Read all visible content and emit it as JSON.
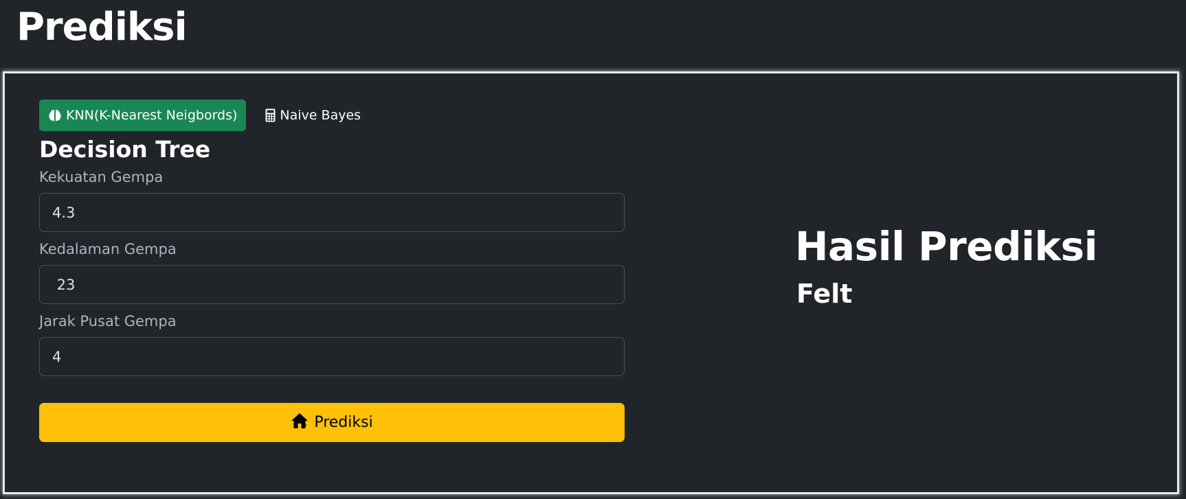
{
  "page": {
    "title": "Prediksi"
  },
  "tabs": [
    {
      "label": "KNN(K-Nearest Neigbords)",
      "icon": "brain-icon",
      "active": true
    },
    {
      "label": "Naive Bayes",
      "icon": "calculator-icon",
      "active": false
    }
  ],
  "form": {
    "section_title": "Decision Tree",
    "fields": [
      {
        "label": "Kekuatan Gempa",
        "value": "4.3"
      },
      {
        "label": "Kedalaman Gempa",
        "value": " 23"
      },
      {
        "label": "Jarak Pusat Gempa",
        "value": "4"
      }
    ],
    "submit": {
      "label": "Prediksi",
      "icon": "house-icon"
    }
  },
  "result": {
    "title": "Hasil Prediksi",
    "value": "Felt"
  },
  "colors": {
    "background": "#212529",
    "active_tab": "#198754",
    "submit_button": "#ffc107",
    "label_text": "#adb5bd"
  }
}
